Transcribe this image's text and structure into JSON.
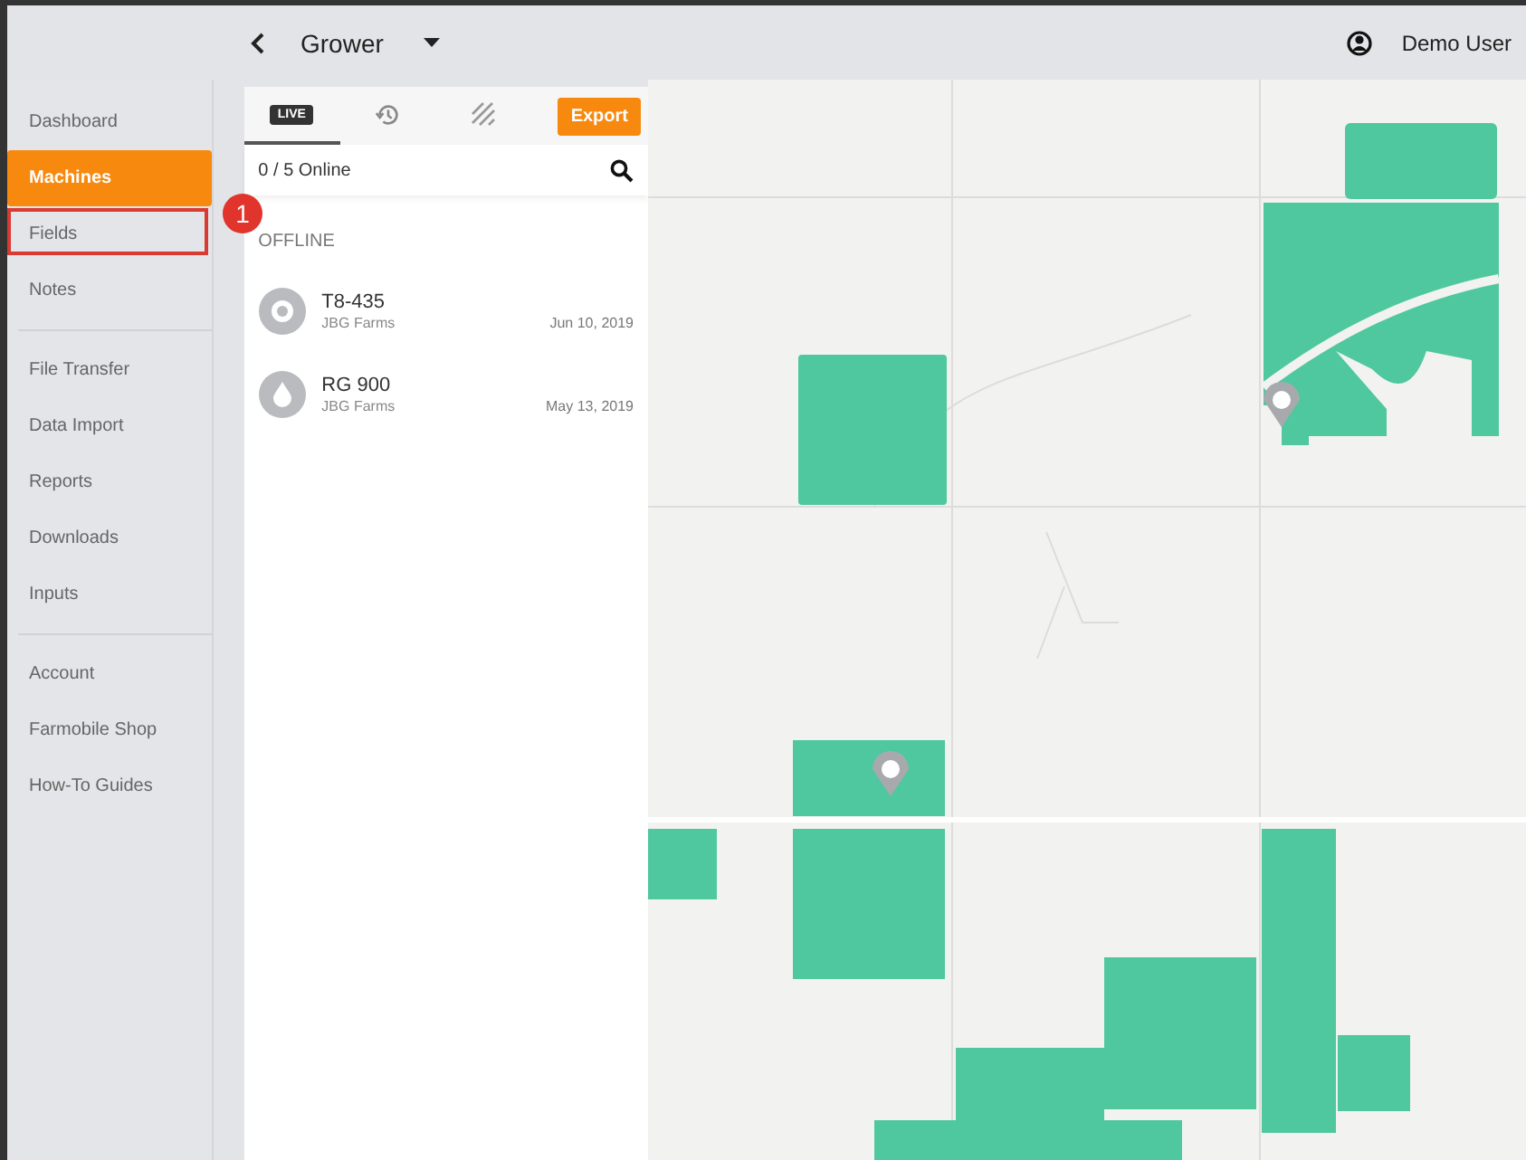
{
  "header": {
    "title": "Grower",
    "user": "Demo User"
  },
  "sidebar": {
    "groups": [
      {
        "items": [
          {
            "label": "Dashboard",
            "selected": false,
            "highlighted": false
          },
          {
            "label": "Machines",
            "selected": true,
            "highlighted": false
          },
          {
            "label": "Fields",
            "selected": false,
            "highlighted": true
          },
          {
            "label": "Notes",
            "selected": false,
            "highlighted": false
          }
        ]
      },
      {
        "items": [
          {
            "label": "File Transfer",
            "selected": false,
            "highlighted": false
          },
          {
            "label": "Data Import",
            "selected": false,
            "highlighted": false
          },
          {
            "label": "Reports",
            "selected": false,
            "highlighted": false
          },
          {
            "label": "Downloads",
            "selected": false,
            "highlighted": false
          },
          {
            "label": "Inputs",
            "selected": false,
            "highlighted": false
          }
        ]
      },
      {
        "items": [
          {
            "label": "Account",
            "selected": false,
            "highlighted": false
          },
          {
            "label": "Farmobile Shop",
            "selected": false,
            "highlighted": false
          },
          {
            "label": "How-To Guides",
            "selected": false,
            "highlighted": false
          }
        ]
      }
    ]
  },
  "annotation": {
    "number": "1"
  },
  "panel": {
    "tabs": [
      {
        "kind": "live",
        "label": "LIVE",
        "selected": true
      },
      {
        "kind": "history",
        "selected": false
      },
      {
        "kind": "hatch",
        "selected": false
      }
    ],
    "export_label": "Export",
    "online_count": "0 / 5 Online",
    "section": "OFFLINE",
    "machines": [
      {
        "kind": "target",
        "name": "T8-435",
        "farm": "JBG Farms",
        "date": "Jun 10, 2019"
      },
      {
        "kind": "drop",
        "name": "RG 900",
        "farm": "JBG Farms",
        "date": "May 13, 2019"
      }
    ]
  }
}
